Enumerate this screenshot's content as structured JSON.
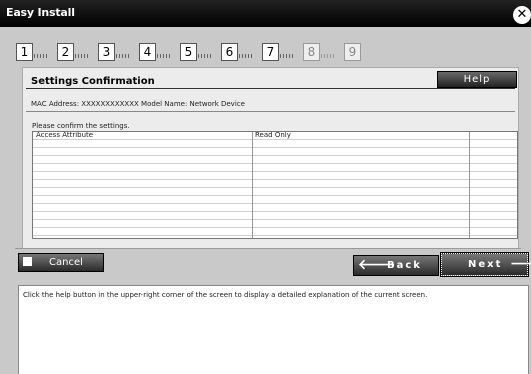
{
  "window": {
    "title": "Easy Install"
  },
  "steps": [
    {
      "label": "1",
      "state": "done"
    },
    {
      "label": "2",
      "state": "done"
    },
    {
      "label": "3",
      "state": "done"
    },
    {
      "label": "4",
      "state": "done"
    },
    {
      "label": "5",
      "state": "done"
    },
    {
      "label": "6",
      "state": "done"
    },
    {
      "label": "7",
      "state": "done"
    },
    {
      "label": "8",
      "state": "future"
    },
    {
      "label": "9",
      "state": "future"
    }
  ],
  "panel": {
    "title": "Settings Confirmation",
    "help_label": "Help",
    "device_info": "MAC Address: XXXXXXXXXXXX    Model Name: Network Device",
    "instruction": "Please confirm the settings."
  },
  "settings_table": {
    "rows": [
      {
        "name": "Access Attribute",
        "value": "Read Only",
        "extra": ""
      }
    ],
    "empty_row_count": 13
  },
  "buttons": {
    "cancel": "Cancel",
    "back": "Back",
    "next": "Next"
  },
  "help_text": "Click the help button in the upper-right corner of the screen to display a detailed explanation of the current screen.",
  "icons": {
    "close": "close-icon",
    "back_arrow": "arrow-left-icon",
    "next_arrow": "arrow-right-icon"
  }
}
